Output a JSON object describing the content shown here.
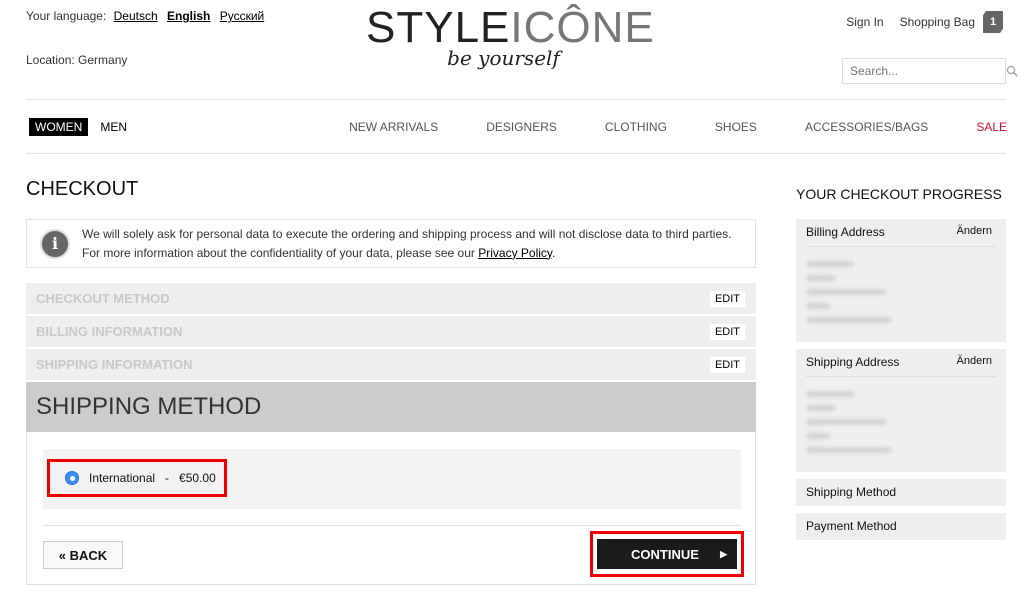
{
  "header": {
    "language_label": "Your language:",
    "languages": [
      "Deutsch",
      "English",
      "Русский"
    ],
    "active_language": "English",
    "location": "Location: Germany",
    "logo_word1": "STYLE",
    "logo_word2": "ICÔNE",
    "logo_tagline": "be yourself",
    "sign_in": "Sign In",
    "shopping_bag": "Shopping Bag",
    "bag_count": "1",
    "search_placeholder": "Search..."
  },
  "nav": {
    "gender_tabs": [
      "WOMEN",
      "MEN"
    ],
    "active_gender": "WOMEN",
    "categories": [
      "NEW ARRIVALS",
      "DESIGNERS",
      "CLOTHING",
      "SHOES",
      "ACCESSORIES/BAGS",
      "SALE"
    ]
  },
  "checkout": {
    "title": "CHECKOUT",
    "notice_line1": "We will solely ask for personal data to execute the ordering and shipping process and will not disclose data to third parties.",
    "notice_line2_prefix": "For more information about the confidentiality of your data, please see our ",
    "privacy_link": "Privacy Policy",
    "notice_line2_suffix": ".",
    "steps": [
      {
        "name": "CHECKOUT METHOD",
        "edit": "EDIT"
      },
      {
        "name": "BILLING INFORMATION",
        "edit": "EDIT"
      },
      {
        "name": "SHIPPING INFORMATION",
        "edit": "EDIT"
      }
    ],
    "shipping_method_title": "SHIPPING METHOD",
    "option_label": "International",
    "option_separator": "-",
    "option_price": "€50.00",
    "back_label": "« BACK",
    "continue_label": "CONTINUE"
  },
  "sidebar": {
    "title": "YOUR CHECKOUT PROGRESS",
    "billing_address": "Billing Address",
    "shipping_address": "Shipping Address",
    "change_label": "Ändern",
    "shipping_method": "Shipping Method",
    "payment_method": "Payment Method"
  },
  "colors": {
    "highlight": "#ee0000",
    "sale": "#c8102e",
    "radio": "#3b8ff5"
  }
}
